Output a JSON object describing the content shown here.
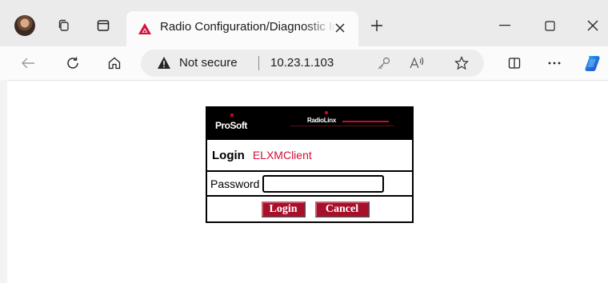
{
  "browser": {
    "tab": {
      "title": "Radio Configuration/Diagnostic Interface",
      "favicon": "prosoft-triangle-icon"
    },
    "address_bar": {
      "security_label": "Not secure",
      "url": "10.23.1.103"
    },
    "icons": {
      "avatar": "profile-avatar",
      "workspaces": "workspaces-icon",
      "tab_actions": "tab-actions-icon",
      "new_tab": "plus-icon",
      "minimize": "minimize-icon",
      "maximize": "maximize-icon",
      "close": "close-icon",
      "back": "back-arrow-icon",
      "refresh": "refresh-icon",
      "home": "home-icon",
      "warning": "warning-triangle-icon",
      "key": "key-icon",
      "read_aloud": "read-aloud-icon",
      "favorite": "star-icon",
      "split_screen": "split-screen-icon",
      "more": "more-dots-icon",
      "copilot": "copilot-icon"
    }
  },
  "login": {
    "banner": {
      "left_logo": "ProSoft",
      "right_logo": "RadioLinx"
    },
    "heading": "Login",
    "client": "ELXMClient",
    "password_label": "Password",
    "password_value": "",
    "login_button": "Login",
    "cancel_button": "Cancel"
  },
  "colors": {
    "accent_red": "#a8102a",
    "client_text": "#d0103a",
    "copilot_blue": "#1e6fe0"
  }
}
